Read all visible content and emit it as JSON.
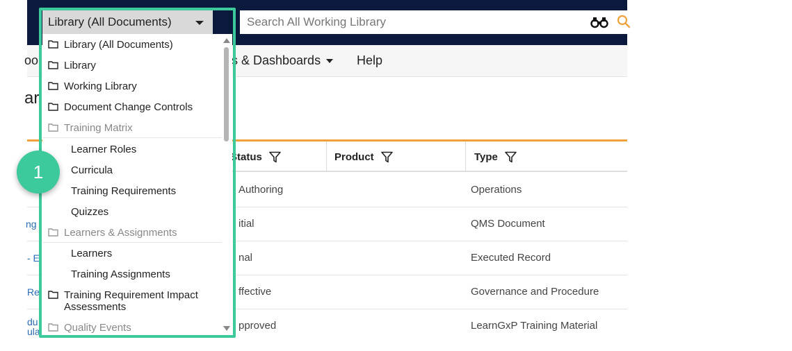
{
  "search": {
    "placeholder": "Search All Working Library"
  },
  "scope_dropdown": {
    "selected": "Library (All Documents)",
    "items": [
      {
        "label": "Library (All Documents)",
        "kind": "folder"
      },
      {
        "label": "Library",
        "kind": "folder"
      },
      {
        "label": "Working Library",
        "kind": "folder"
      },
      {
        "label": "Document Change Controls",
        "kind": "folder"
      },
      {
        "label": "Training Matrix",
        "kind": "group"
      },
      {
        "label": "Learner Roles",
        "kind": "sub"
      },
      {
        "label": "Curricula",
        "kind": "sub"
      },
      {
        "label": "Training Requirements",
        "kind": "sub"
      },
      {
        "label": "Quizzes",
        "kind": "sub"
      },
      {
        "label": "Learners & Assignments",
        "kind": "group"
      },
      {
        "label": "Learners",
        "kind": "sub"
      },
      {
        "label": "Training Assignments",
        "kind": "sub"
      },
      {
        "label": "Training Requirement Impact Assessments",
        "kind": "folder"
      },
      {
        "label": "Quality Events",
        "kind": "group"
      }
    ]
  },
  "nav": {
    "frag_left": "oo",
    "reports": "s & Dashboards",
    "help": "Help"
  },
  "page": {
    "title_fragment": "ar"
  },
  "table": {
    "headers": {
      "status": "Status",
      "product": "Product",
      "type": "Type"
    },
    "rows": [
      {
        "status": "Authoring",
        "type": "Operations",
        "left": ""
      },
      {
        "status": "itial",
        "type": "QMS Document",
        "left": "ng"
      },
      {
        "status": "nal",
        "type": "Executed Record",
        "left": "- E"
      },
      {
        "status": "ffective",
        "type": "Governance and Procedure",
        "left": "Re"
      },
      {
        "status": "pproved",
        "type": "LearnGxP Training Material",
        "left": "du"
      }
    ],
    "last_row_left_2": "ula"
  },
  "callout": {
    "step": "1"
  },
  "colors": {
    "accent": "#3cc99c",
    "header_bg": "#0b1a3c",
    "orange": "#f0a23a",
    "search_icon": "#f0a23a"
  },
  "icons": [
    "binoculars-icon",
    "search-icon",
    "filter-icon",
    "folder-icon",
    "caret-down-icon"
  ]
}
